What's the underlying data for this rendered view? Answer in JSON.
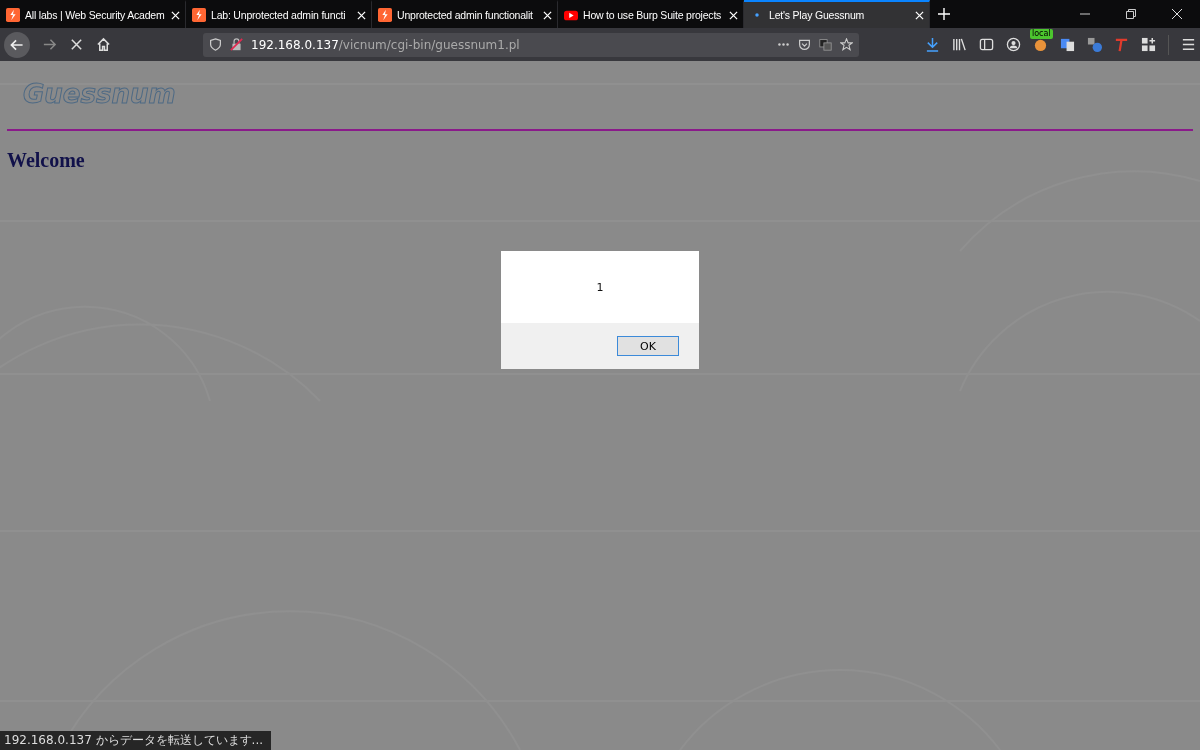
{
  "tabs": [
    {
      "title": "All labs | Web Security Academ",
      "kind": "burp",
      "selected": false
    },
    {
      "title": "Lab: Unprotected admin functi",
      "kind": "burp",
      "selected": false
    },
    {
      "title": "Unprotected admin functionalit",
      "kind": "burp",
      "selected": false
    },
    {
      "title": "How to use Burp Suite projects",
      "kind": "video",
      "selected": false
    },
    {
      "title": "Let's Play Guessnum",
      "kind": "loading",
      "selected": true
    }
  ],
  "toolbar": {
    "loading": true,
    "url_host": "192.168.0.137",
    "url_path": "/vicnum/cgi-bin/guessnum1.pl",
    "extension_badge": "local"
  },
  "page": {
    "logo": "Guessnum",
    "heading": "Welcome"
  },
  "dialog": {
    "message": "1",
    "button": "OK"
  },
  "status_bar": {
    "text": "192.168.0.137 からデータを転送しています..."
  }
}
